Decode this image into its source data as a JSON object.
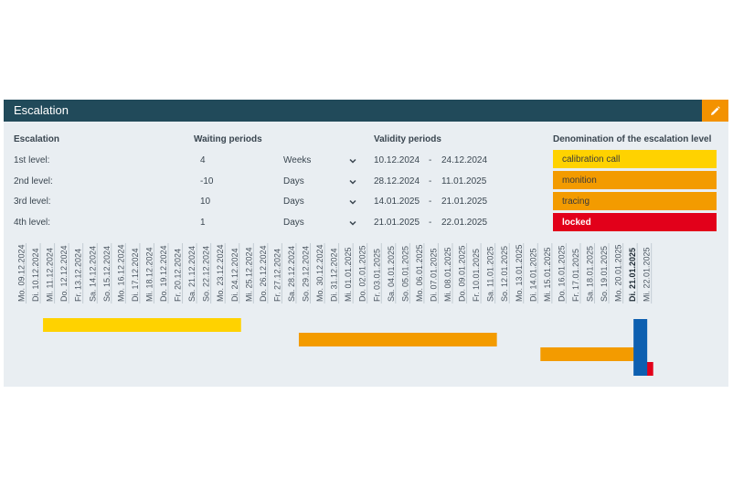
{
  "panel": {
    "title": "Escalation"
  },
  "columns": {
    "escalation": "Escalation",
    "waiting": "Waiting periods",
    "validity": "Validity periods",
    "denomination": "Denomination of the escalation level"
  },
  "levels": [
    {
      "label": "1st level:",
      "value": "4",
      "unit": "Weeks",
      "from": "10.12.2024",
      "sep": "-",
      "to": "24.12.2024",
      "denomination": "calibration call",
      "color": "#ffd200",
      "text_color": "#3a3a3a"
    },
    {
      "label": "2nd level:",
      "value": "-10",
      "unit": "Days",
      "from": "28.12.2024",
      "sep": "-",
      "to": "11.01.2025",
      "denomination": "monition",
      "color": "#f39b00",
      "text_color": "#3a3a3a"
    },
    {
      "label": "3rd level:",
      "value": "10",
      "unit": "Days",
      "from": "14.01.2025",
      "sep": "-",
      "to": "21.01.2025",
      "denomination": "tracing",
      "color": "#f39b00",
      "text_color": "#3a3a3a"
    },
    {
      "label": "4th level:",
      "value": "1",
      "unit": "Days",
      "from": "21.01.2025",
      "sep": "-",
      "to": "22.01.2025",
      "denomination": "locked",
      "color": "#e2001a",
      "text_color": "#ffffff"
    }
  ],
  "timeline": {
    "dates": [
      "Mo. 09.12.2024",
      "Di. 10.12.2024",
      "Mi. 11.12.2024",
      "Do. 12.12.2024",
      "Fr. 13.12.2024",
      "Sa. 14.12.2024",
      "So. 15.12.2024",
      "Mo. 16.12.2024",
      "Di. 17.12.2024",
      "Mi. 18.12.2024",
      "Do. 19.12.2024",
      "Fr. 20.12.2024",
      "Sa. 21.12.2024",
      "So. 22.12.2024",
      "Mo. 23.12.2024",
      "Di. 24.12.2024",
      "Mi. 25.12.2024",
      "Do. 26.12.2024",
      "Fr. 27.12.2024",
      "Sa. 28.12.2024",
      "So. 29.12.2024",
      "Mo. 30.12.2024",
      "Di. 31.12.2024",
      "Mi. 01.01.2025",
      "Do. 02.01.2025",
      "Fr. 03.01.2025",
      "Sa. 04.01.2025",
      "So. 05.01.2025",
      "Mo. 06.01.2025",
      "Di. 07.01.2025",
      "Mi. 08.01.2025",
      "Do. 09.01.2025",
      "Fr. 10.01.2025",
      "Sa. 11.01.2025",
      "So. 12.01.2025",
      "Mo. 13.01.2025",
      "Di. 14.01.2025",
      "Mi. 15.01.2025",
      "Do. 16.01.2025",
      "Fr. 17.01.2025",
      "Sa. 18.01.2025",
      "So. 19.01.2025",
      "Mo. 20.01.2025",
      "Di. 21.01.2025",
      "Mi. 22.01.2025"
    ],
    "today": "Di. 21.01.2025",
    "bars": [
      {
        "level": 1,
        "start": "10.12.2024",
        "end": "24.12.2024",
        "color": "#ffd200"
      },
      {
        "level": 2,
        "start": "28.12.2024",
        "end": "11.01.2025",
        "color": "#f39b00"
      },
      {
        "level": 3,
        "start": "14.01.2025",
        "end": "21.01.2025",
        "color": "#f39b00"
      },
      {
        "level": 4,
        "start": "21.01.2025",
        "end": "22.01.2025",
        "color": "#e2001a"
      }
    ],
    "today_color": "#0d5fb0"
  }
}
